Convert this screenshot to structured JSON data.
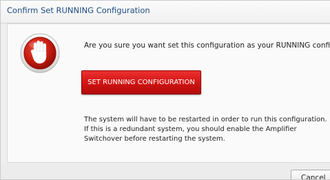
{
  "dialog": {
    "title": "Confirm Set RUNNING Configuration",
    "icon": "stop-hand-icon",
    "question": "Are you sure you want set this configuration as your RUNNING configuration?",
    "primary_button_label": "SET RUNNING CONFIGURATION",
    "info_text": "The system will have to be restarted in order to run this configuration. If this is a redundant system, you should enable the Amplifier Switchover before restarting the system.",
    "cancel_label": "Cancel"
  },
  "colors": {
    "title_text": "#1e4d82",
    "primary_button": "#d11515",
    "stop_icon_red": "#c41a10"
  }
}
